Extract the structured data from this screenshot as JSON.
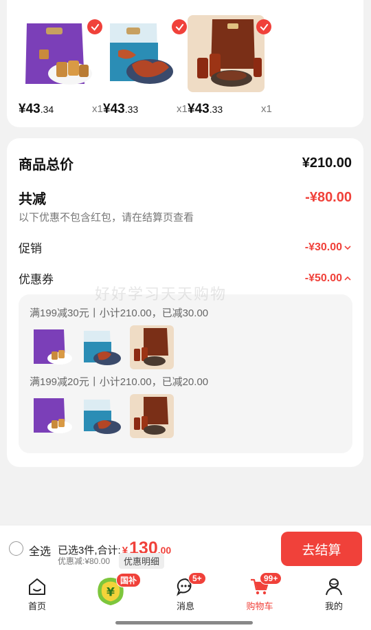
{
  "products": [
    {
      "price_int": "¥43",
      "price_dec": ".34",
      "qty": "x1",
      "image": "purple-snack-bag"
    },
    {
      "price_int": "¥43",
      "price_dec": ".33",
      "qty": "x1",
      "image": "blue-snack-bag"
    },
    {
      "price_int": "¥43",
      "price_dec": ".33",
      "qty": "x1",
      "image": "brown-snack-bag"
    }
  ],
  "summary": {
    "total_label": "商品总价",
    "total_value": "¥210.00",
    "reduce_label": "共减",
    "reduce_value": "-¥80.00",
    "reduce_note": "以下优惠不包含红包，请在结算页查看",
    "promo_label": "促销",
    "promo_value": "-¥30.00",
    "coupon_label": "优惠券",
    "coupon_value": "-¥50.00",
    "watermark": "好好学习天天购物",
    "promo_groups": [
      {
        "title": "满199减30元丨小计210.00，已减30.00"
      },
      {
        "title": "满199减20元丨小计210.00，已减20.00"
      }
    ]
  },
  "checkout": {
    "select_all": "全选",
    "selected_text": "已选3件,合计:",
    "yen": "¥",
    "total_int": "130",
    "total_dec": ".00",
    "discount_text": "优惠减:¥80.00",
    "detail_button": "优惠明细",
    "checkout_button": "去结算"
  },
  "tabs": [
    {
      "label": "首页",
      "icon": "home-icon"
    },
    {
      "label": "",
      "icon": "subsidy-icon",
      "badge": "国补"
    },
    {
      "label": "消息",
      "icon": "message-icon",
      "badge": "5+"
    },
    {
      "label": "购物车",
      "icon": "cart-icon",
      "badge": "99+",
      "active": true
    },
    {
      "label": "我的",
      "icon": "profile-icon"
    }
  ],
  "colors": {
    "accent": "#f0413a"
  }
}
